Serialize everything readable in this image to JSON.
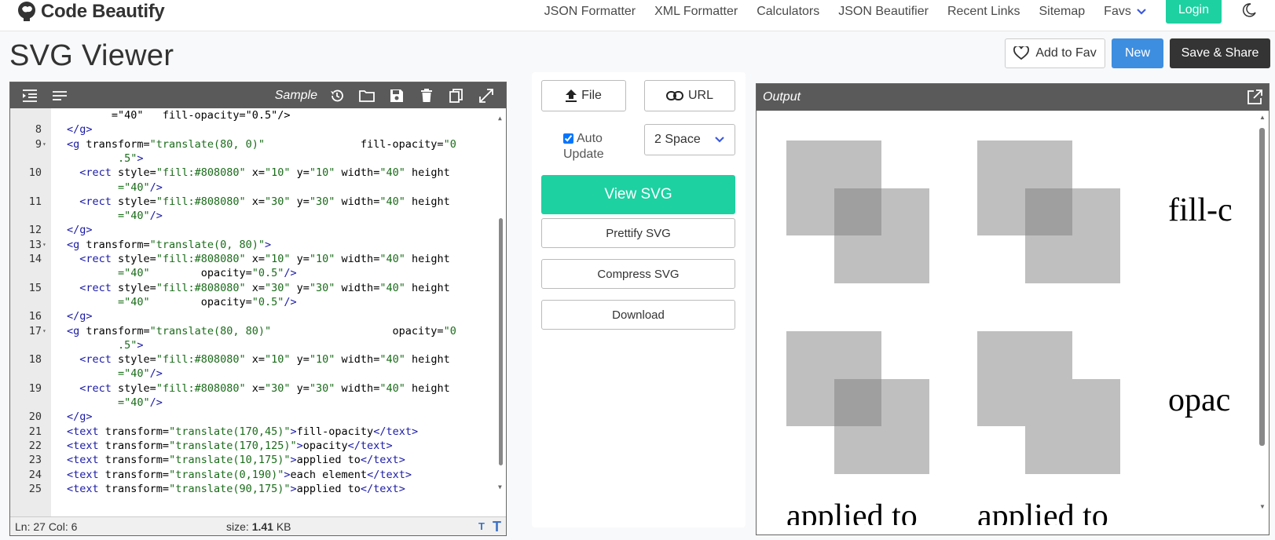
{
  "nav": {
    "brand": "Code Beautify",
    "links": [
      "JSON Formatter",
      "XML Formatter",
      "Calculators",
      "JSON Beautifier",
      "Recent Links",
      "Sitemap"
    ],
    "favs": "Favs",
    "login": "Login"
  },
  "header": {
    "title": "SVG Viewer",
    "add_fav": "Add to Fav",
    "new": "New",
    "save_share": "Save & Share"
  },
  "editor": {
    "sample": "Sample",
    "status_pos": "Ln: 27 Col: 6",
    "size_label": "size: ",
    "size_value": "1.41",
    "size_unit": " KB",
    "lines": [
      {
        "n": "",
        "parts": [
          [
            "attr",
            "       =\"40\"   fill-opacity=\"0.5\"/>"
          ]
        ]
      },
      {
        "n": "8",
        "parts": [
          [
            "tag",
            "</g>"
          ]
        ]
      },
      {
        "n": "9",
        "fold": true,
        "parts": [
          [
            "tag",
            "<g "
          ],
          [
            "attr",
            "transform="
          ],
          [
            "val",
            "\"translate(80, 0)\""
          ],
          [
            "attr",
            "               fill-opacity="
          ],
          [
            "val",
            "\"0"
          ]
        ]
      },
      {
        "n": "",
        "parts": [
          [
            "val",
            "        .5\""
          ],
          [
            "tag",
            ">"
          ]
        ]
      },
      {
        "n": "10",
        "parts": [
          [
            "tag",
            "  <rect "
          ],
          [
            "attr",
            "style="
          ],
          [
            "val",
            "\"fill:#808080\""
          ],
          [
            "attr",
            " x="
          ],
          [
            "val",
            "\"10\""
          ],
          [
            "attr",
            " y="
          ],
          [
            "val",
            "\"10\""
          ],
          [
            "attr",
            " width="
          ],
          [
            "val",
            "\"40\""
          ],
          [
            "attr",
            " height"
          ]
        ]
      },
      {
        "n": "",
        "parts": [
          [
            "val",
            "        =\"40\""
          ],
          [
            "tag",
            "/>"
          ]
        ]
      },
      {
        "n": "11",
        "parts": [
          [
            "tag",
            "  <rect "
          ],
          [
            "attr",
            "style="
          ],
          [
            "val",
            "\"fill:#808080\""
          ],
          [
            "attr",
            " x="
          ],
          [
            "val",
            "\"30\""
          ],
          [
            "attr",
            " y="
          ],
          [
            "val",
            "\"30\""
          ],
          [
            "attr",
            " width="
          ],
          [
            "val",
            "\"40\""
          ],
          [
            "attr",
            " height"
          ]
        ]
      },
      {
        "n": "",
        "parts": [
          [
            "val",
            "        =\"40\""
          ],
          [
            "tag",
            "/>"
          ]
        ]
      },
      {
        "n": "12",
        "parts": [
          [
            "tag",
            "</g>"
          ]
        ]
      },
      {
        "n": "13",
        "fold": true,
        "parts": [
          [
            "tag",
            "<g "
          ],
          [
            "attr",
            "transform="
          ],
          [
            "val",
            "\"translate(0, 80)\""
          ],
          [
            "tag",
            ">"
          ]
        ]
      },
      {
        "n": "14",
        "parts": [
          [
            "tag",
            "  <rect "
          ],
          [
            "attr",
            "style="
          ],
          [
            "val",
            "\"fill:#808080\""
          ],
          [
            "attr",
            " x="
          ],
          [
            "val",
            "\"10\""
          ],
          [
            "attr",
            " y="
          ],
          [
            "val",
            "\"10\""
          ],
          [
            "attr",
            " width="
          ],
          [
            "val",
            "\"40\""
          ],
          [
            "attr",
            " height"
          ]
        ]
      },
      {
        "n": "",
        "parts": [
          [
            "val",
            "        =\"40\""
          ],
          [
            "attr",
            "        opacity="
          ],
          [
            "val",
            "\"0.5\""
          ],
          [
            "tag",
            "/>"
          ]
        ]
      },
      {
        "n": "15",
        "parts": [
          [
            "tag",
            "  <rect "
          ],
          [
            "attr",
            "style="
          ],
          [
            "val",
            "\"fill:#808080\""
          ],
          [
            "attr",
            " x="
          ],
          [
            "val",
            "\"30\""
          ],
          [
            "attr",
            " y="
          ],
          [
            "val",
            "\"30\""
          ],
          [
            "attr",
            " width="
          ],
          [
            "val",
            "\"40\""
          ],
          [
            "attr",
            " height"
          ]
        ]
      },
      {
        "n": "",
        "parts": [
          [
            "val",
            "        =\"40\""
          ],
          [
            "attr",
            "        opacity="
          ],
          [
            "val",
            "\"0.5\""
          ],
          [
            "tag",
            "/>"
          ]
        ]
      },
      {
        "n": "16",
        "parts": [
          [
            "tag",
            "</g>"
          ]
        ]
      },
      {
        "n": "17",
        "fold": true,
        "parts": [
          [
            "tag",
            "<g "
          ],
          [
            "attr",
            "transform="
          ],
          [
            "val",
            "\"translate(80, 80)\""
          ],
          [
            "attr",
            "                   opacity="
          ],
          [
            "val",
            "\"0"
          ]
        ]
      },
      {
        "n": "",
        "parts": [
          [
            "val",
            "        .5\""
          ],
          [
            "tag",
            ">"
          ]
        ]
      },
      {
        "n": "18",
        "parts": [
          [
            "tag",
            "  <rect "
          ],
          [
            "attr",
            "style="
          ],
          [
            "val",
            "\"fill:#808080\""
          ],
          [
            "attr",
            " x="
          ],
          [
            "val",
            "\"10\""
          ],
          [
            "attr",
            " y="
          ],
          [
            "val",
            "\"10\""
          ],
          [
            "attr",
            " width="
          ],
          [
            "val",
            "\"40\""
          ],
          [
            "attr",
            " height"
          ]
        ]
      },
      {
        "n": "",
        "parts": [
          [
            "val",
            "        =\"40\""
          ],
          [
            "tag",
            "/>"
          ]
        ]
      },
      {
        "n": "19",
        "parts": [
          [
            "tag",
            "  <rect "
          ],
          [
            "attr",
            "style="
          ],
          [
            "val",
            "\"fill:#808080\""
          ],
          [
            "attr",
            " x="
          ],
          [
            "val",
            "\"30\""
          ],
          [
            "attr",
            " y="
          ],
          [
            "val",
            "\"30\""
          ],
          [
            "attr",
            " width="
          ],
          [
            "val",
            "\"40\""
          ],
          [
            "attr",
            " height"
          ]
        ]
      },
      {
        "n": "",
        "parts": [
          [
            "val",
            "        =\"40\""
          ],
          [
            "tag",
            "/>"
          ]
        ]
      },
      {
        "n": "20",
        "parts": [
          [
            "tag",
            "</g>"
          ]
        ]
      },
      {
        "n": "21",
        "parts": [
          [
            "tag",
            "<text "
          ],
          [
            "attr",
            "transform="
          ],
          [
            "val",
            "\"translate(170,45)\""
          ],
          [
            "tag",
            ">"
          ],
          [
            "txt",
            "fill-opacity"
          ],
          [
            "tag",
            "</text>"
          ]
        ]
      },
      {
        "n": "22",
        "parts": [
          [
            "tag",
            "<text "
          ],
          [
            "attr",
            "transform="
          ],
          [
            "val",
            "\"translate(170,125)\""
          ],
          [
            "tag",
            ">"
          ],
          [
            "txt",
            "opacity"
          ],
          [
            "tag",
            "</text>"
          ]
        ]
      },
      {
        "n": "23",
        "parts": [
          [
            "tag",
            "<text "
          ],
          [
            "attr",
            "transform="
          ],
          [
            "val",
            "\"translate(10,175)\""
          ],
          [
            "tag",
            ">"
          ],
          [
            "txt",
            "applied to"
          ],
          [
            "tag",
            "</text>"
          ]
        ]
      },
      {
        "n": "24",
        "parts": [
          [
            "tag",
            "<text "
          ],
          [
            "attr",
            "transform="
          ],
          [
            "val",
            "\"translate(0,190)\""
          ],
          [
            "tag",
            ">"
          ],
          [
            "txt",
            "each element"
          ],
          [
            "tag",
            "</text>"
          ]
        ]
      },
      {
        "n": "25",
        "parts": [
          [
            "tag",
            "<text "
          ],
          [
            "attr",
            "transform="
          ],
          [
            "val",
            "\"translate(90,175)\""
          ],
          [
            "tag",
            ">"
          ],
          [
            "txt",
            "applied to"
          ],
          [
            "tag",
            "</text>"
          ]
        ]
      }
    ]
  },
  "middle": {
    "file": "File",
    "url": "URL",
    "auto_update_1": "Auto",
    "auto_update_2": "Update",
    "auto_update_checked": true,
    "space": "2 Space",
    "view": "View SVG",
    "prettify": "Prettify SVG",
    "compress": "Compress SVG",
    "download": "Download"
  },
  "output": {
    "title": "Output",
    "label_fill_opacity": "fill-c",
    "label_opacity": "opac",
    "label_applied_1": "applied to",
    "label_applied_2": "applied to",
    "colors": {
      "rect_fill": "#808080"
    }
  },
  "colors": {
    "accent": "#1dd1a1",
    "primary": "#3d8ee0",
    "dark": "#343434",
    "toolbar": "#5a5a5a"
  }
}
